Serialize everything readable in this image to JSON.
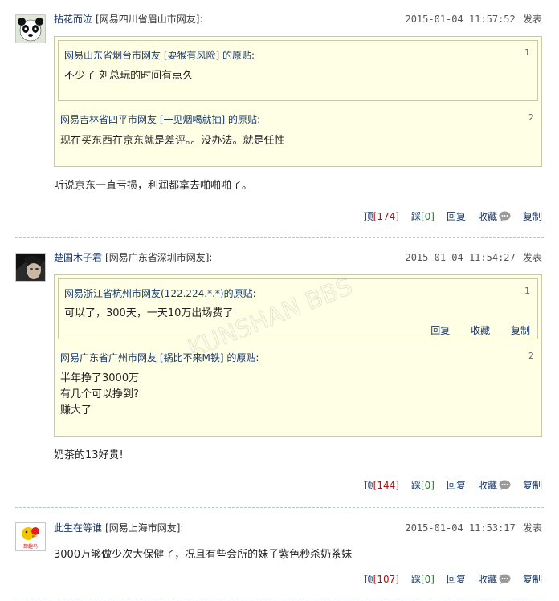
{
  "posts": [
    {
      "username": "拈花而泣",
      "location": "[网易四川省眉山市网友]:",
      "datetime": "2015-01-04 11:57:52",
      "publish_label": "发表",
      "avatar_icon": "panda-avatar",
      "quotes": [
        {
          "header": "网易山东省烟台市网友 [耍猴有风险] 的原贴:",
          "num": "1",
          "lines": [
            "不少了 刘总玩的时间有点久"
          ]
        },
        {
          "header": "网易吉林省四平市网友 [一见烟喝就抽] 的原贴:",
          "num": "2",
          "lines": [
            "现在买东西在京东就是差评。。没办法。就是任性"
          ]
        }
      ],
      "comment": "听说京东一直亏损，利润都拿去啪啪啪了。",
      "actions": {
        "up_label": "顶",
        "up_count": "[174]",
        "down_label": "踩",
        "down_count": "[0]",
        "reply": "回复",
        "fav": "收藏",
        "copy": "复制"
      }
    },
    {
      "username": "楚国木子君",
      "location": "[网易广东省深圳市网友]:",
      "datetime": "2015-01-04 11:54:27",
      "publish_label": "发表",
      "avatar_icon": "person-avatar",
      "quotes": [
        {
          "header": "网易浙江省杭州市网友(122.224.*.*)的原贴:",
          "num": "1",
          "lines": [
            "可以了，300天，一天10万出场费了"
          ],
          "inner_actions": {
            "reply": "回复",
            "fav": "收藏",
            "copy": "复制"
          }
        },
        {
          "header": "网易广东省广州市网友 [锅比不来M铁] 的原贴:",
          "num": "2",
          "lines": [
            "半年挣了3000万",
            "有几个可以挣到?",
            "赚大了"
          ]
        }
      ],
      "comment": "奶茶的13好贵!",
      "actions": {
        "up_label": "顶",
        "up_count": "[144]",
        "down_label": "踩",
        "down_count": "[0]",
        "reply": "回复",
        "fav": "收藏",
        "copy": "复制"
      }
    },
    {
      "username": "此生在等谁",
      "location": "[网易上海市网友]:",
      "datetime": "2015-01-04 11:53:17",
      "publish_label": "发表",
      "avatar_icon": "logo-avatar",
      "avatar_text": "肆趣鸟",
      "comment": "3000万够做少次大保健了，况且有些会所的妹子紫色秒杀奶茶妹",
      "actions": {
        "up_label": "顶",
        "up_count": "[107]",
        "down_label": "踩",
        "down_count": "[0]",
        "reply": "回复",
        "fav": "收藏",
        "copy": "复制"
      }
    }
  ],
  "watermark": "KUNSHAN BBS"
}
